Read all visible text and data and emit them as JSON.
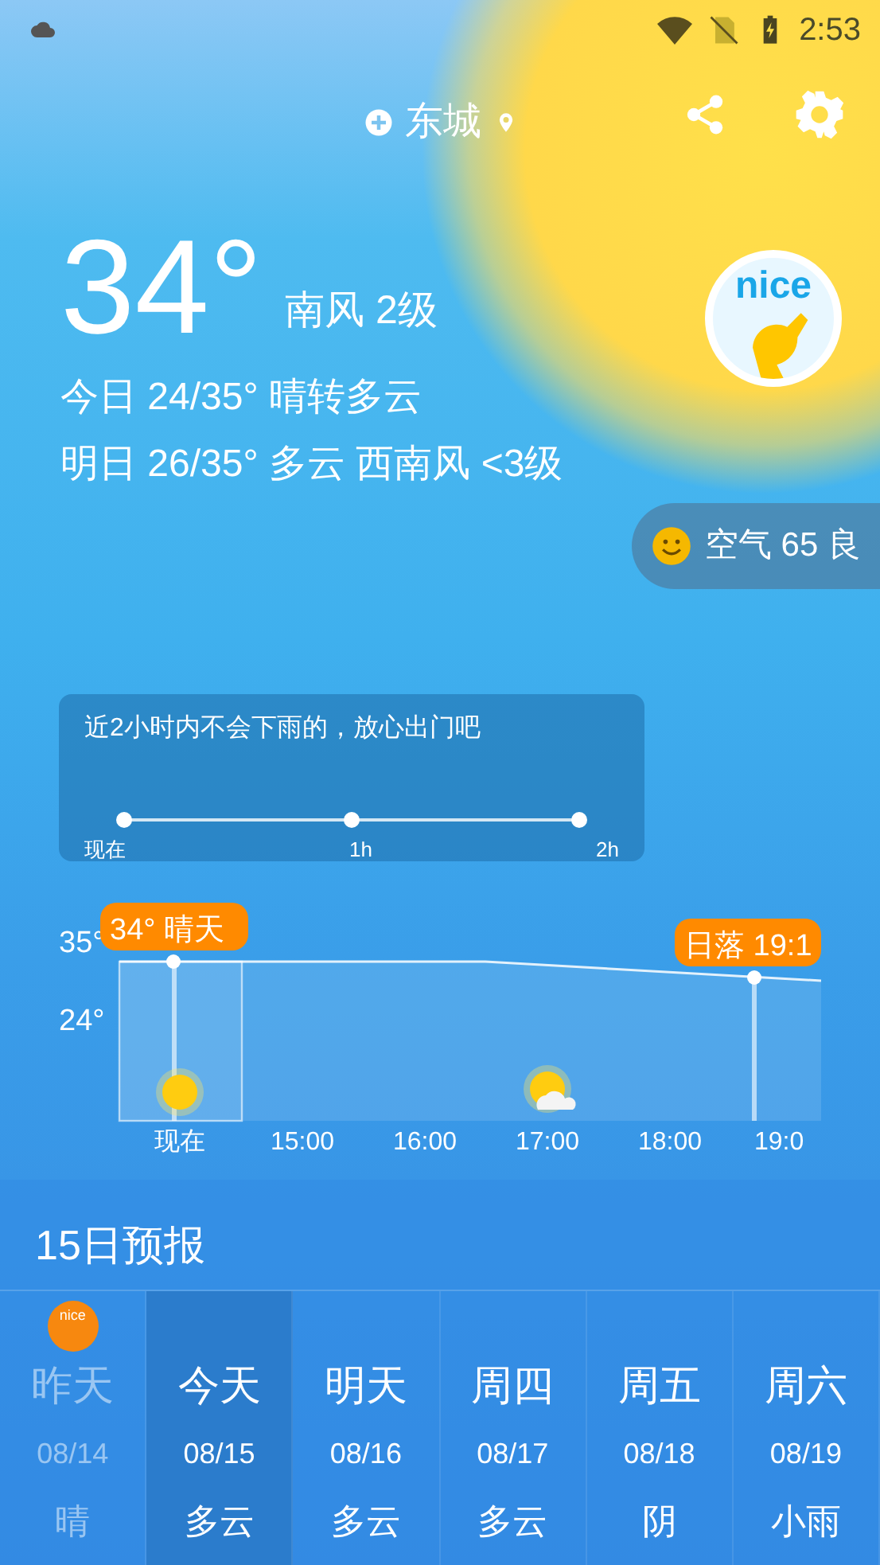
{
  "status_bar": {
    "time": "2:53"
  },
  "header": {
    "city": "东城"
  },
  "current": {
    "temperature": "34°",
    "wind": "南风 2级",
    "today": "今日 24/35° 晴转多云",
    "tomorrow": "明日 26/35° 多云 西南风 <3级"
  },
  "logo": {
    "text": "nice"
  },
  "air_quality": {
    "text": "空气 65 良"
  },
  "rain": {
    "message": "近2小时内不会下雨的，放心出门吧",
    "ticks": [
      "现在",
      "1h",
      "2h"
    ]
  },
  "hourly": {
    "y_labels": [
      "35°",
      "24°"
    ],
    "x_labels": [
      "现在",
      "15:00",
      "16:00",
      "17:00",
      "18:00",
      "19:0"
    ],
    "now_callout": "34° 晴天",
    "sunset_callout": "日落 19:1",
    "icons": [
      {
        "kind": "sunny"
      },
      {
        "kind": "none"
      },
      {
        "kind": "none"
      },
      {
        "kind": "partly_cloudy"
      },
      {
        "kind": "none"
      },
      {
        "kind": "none"
      }
    ]
  },
  "forecast": {
    "title": "15日预报",
    "days": [
      {
        "day": "昨天",
        "date": "08/14",
        "weather": "晴",
        "selected": false,
        "past": true,
        "badge": "nice"
      },
      {
        "day": "今天",
        "date": "08/15",
        "weather": "多云",
        "selected": true,
        "past": false
      },
      {
        "day": "明天",
        "date": "08/16",
        "weather": "多云",
        "selected": false,
        "past": false
      },
      {
        "day": "周四",
        "date": "08/17",
        "weather": "多云",
        "selected": false,
        "past": false
      },
      {
        "day": "周五",
        "date": "08/18",
        "weather": "阴",
        "selected": false,
        "past": false
      },
      {
        "day": "周六",
        "date": "08/19",
        "weather": "小雨",
        "selected": false,
        "past": false
      }
    ]
  }
}
